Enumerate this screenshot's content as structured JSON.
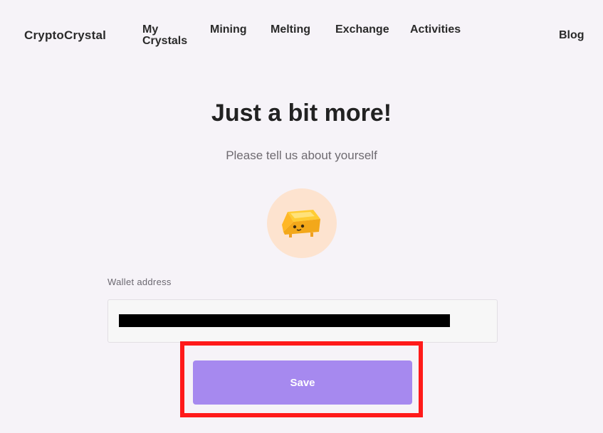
{
  "nav": {
    "brand": "CryptoCrystal",
    "links": [
      "My Crystals",
      "Mining",
      "Melting",
      "Exchange",
      "Activities"
    ],
    "blog": "Blog"
  },
  "main": {
    "title": "Just a bit more!",
    "subtitle": "Please tell us about yourself",
    "avatar_icon": "gold-bar-character-icon",
    "wallet_label": "Wallet address",
    "wallet_value_redacted": true,
    "save_label": "Save"
  },
  "colors": {
    "background": "#f6f3f8",
    "button": "#a689ef",
    "avatar_bg": "#fde3cf",
    "highlight": "#ff1a1a"
  }
}
